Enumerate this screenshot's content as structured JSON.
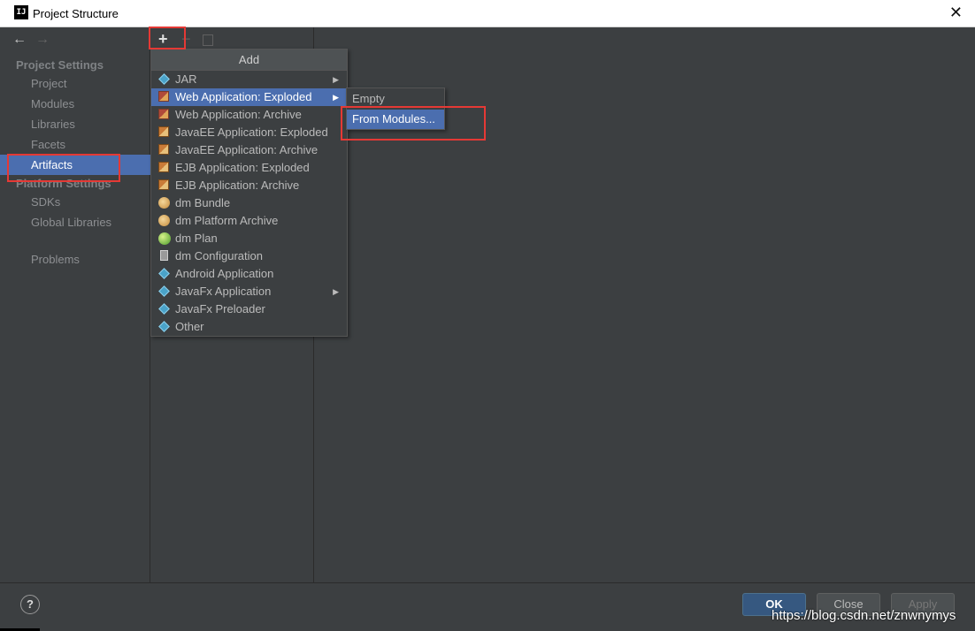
{
  "window": {
    "title": "Project Structure",
    "logo_text": "IJ"
  },
  "sidebar": {
    "project_settings_header": "Project Settings",
    "platform_settings_header": "Platform Settings",
    "items": [
      {
        "label": "Project"
      },
      {
        "label": "Modules"
      },
      {
        "label": "Libraries"
      },
      {
        "label": "Facets"
      },
      {
        "label": "Artifacts"
      }
    ],
    "platform_items": [
      {
        "label": "SDKs"
      },
      {
        "label": "Global Libraries"
      }
    ],
    "problems": "Problems",
    "selected": "Artifacts"
  },
  "toolbar": {
    "add": "+",
    "remove": "−"
  },
  "add_menu": {
    "header": "Add",
    "items": [
      {
        "label": "JAR",
        "icon": "diamond-icon"
      },
      {
        "label": "Web Application: Exploded",
        "icon": "war-icon"
      },
      {
        "label": "Web Application: Archive",
        "icon": "war-icon"
      },
      {
        "label": "JavaEE Application: Exploded",
        "icon": "ear-icon"
      },
      {
        "label": "JavaEE Application: Archive",
        "icon": "ear-icon"
      },
      {
        "label": "EJB Application: Exploded",
        "icon": "ear-icon"
      },
      {
        "label": "EJB Application: Archive",
        "icon": "ear-icon"
      },
      {
        "label": "dm Bundle",
        "icon": "bundle-icon"
      },
      {
        "label": "dm Platform Archive",
        "icon": "bundle-icon"
      },
      {
        "label": "dm Plan",
        "icon": "plan-icon"
      },
      {
        "label": "dm Configuration",
        "icon": "config-icon"
      },
      {
        "label": "Android Application",
        "icon": "diamond-icon"
      },
      {
        "label": "JavaFx Application",
        "icon": "diamond-icon"
      },
      {
        "label": "JavaFx Preloader",
        "icon": "diamond-icon"
      },
      {
        "label": "Other",
        "icon": "diamond-icon"
      }
    ],
    "highlighted": "Web Application: Exploded"
  },
  "submenu": {
    "items": [
      {
        "label": "Empty"
      },
      {
        "label": "From Modules..."
      }
    ],
    "highlighted": "From Modules..."
  },
  "footer": {
    "help": "?",
    "ok": "OK",
    "close": "Close",
    "apply": "Apply",
    "watermark": "https://blog.csdn.net/znwnymys"
  },
  "colors": {
    "accent": "#4b6eaf",
    "background": "#3c3f41",
    "annotation": "#e53935"
  }
}
